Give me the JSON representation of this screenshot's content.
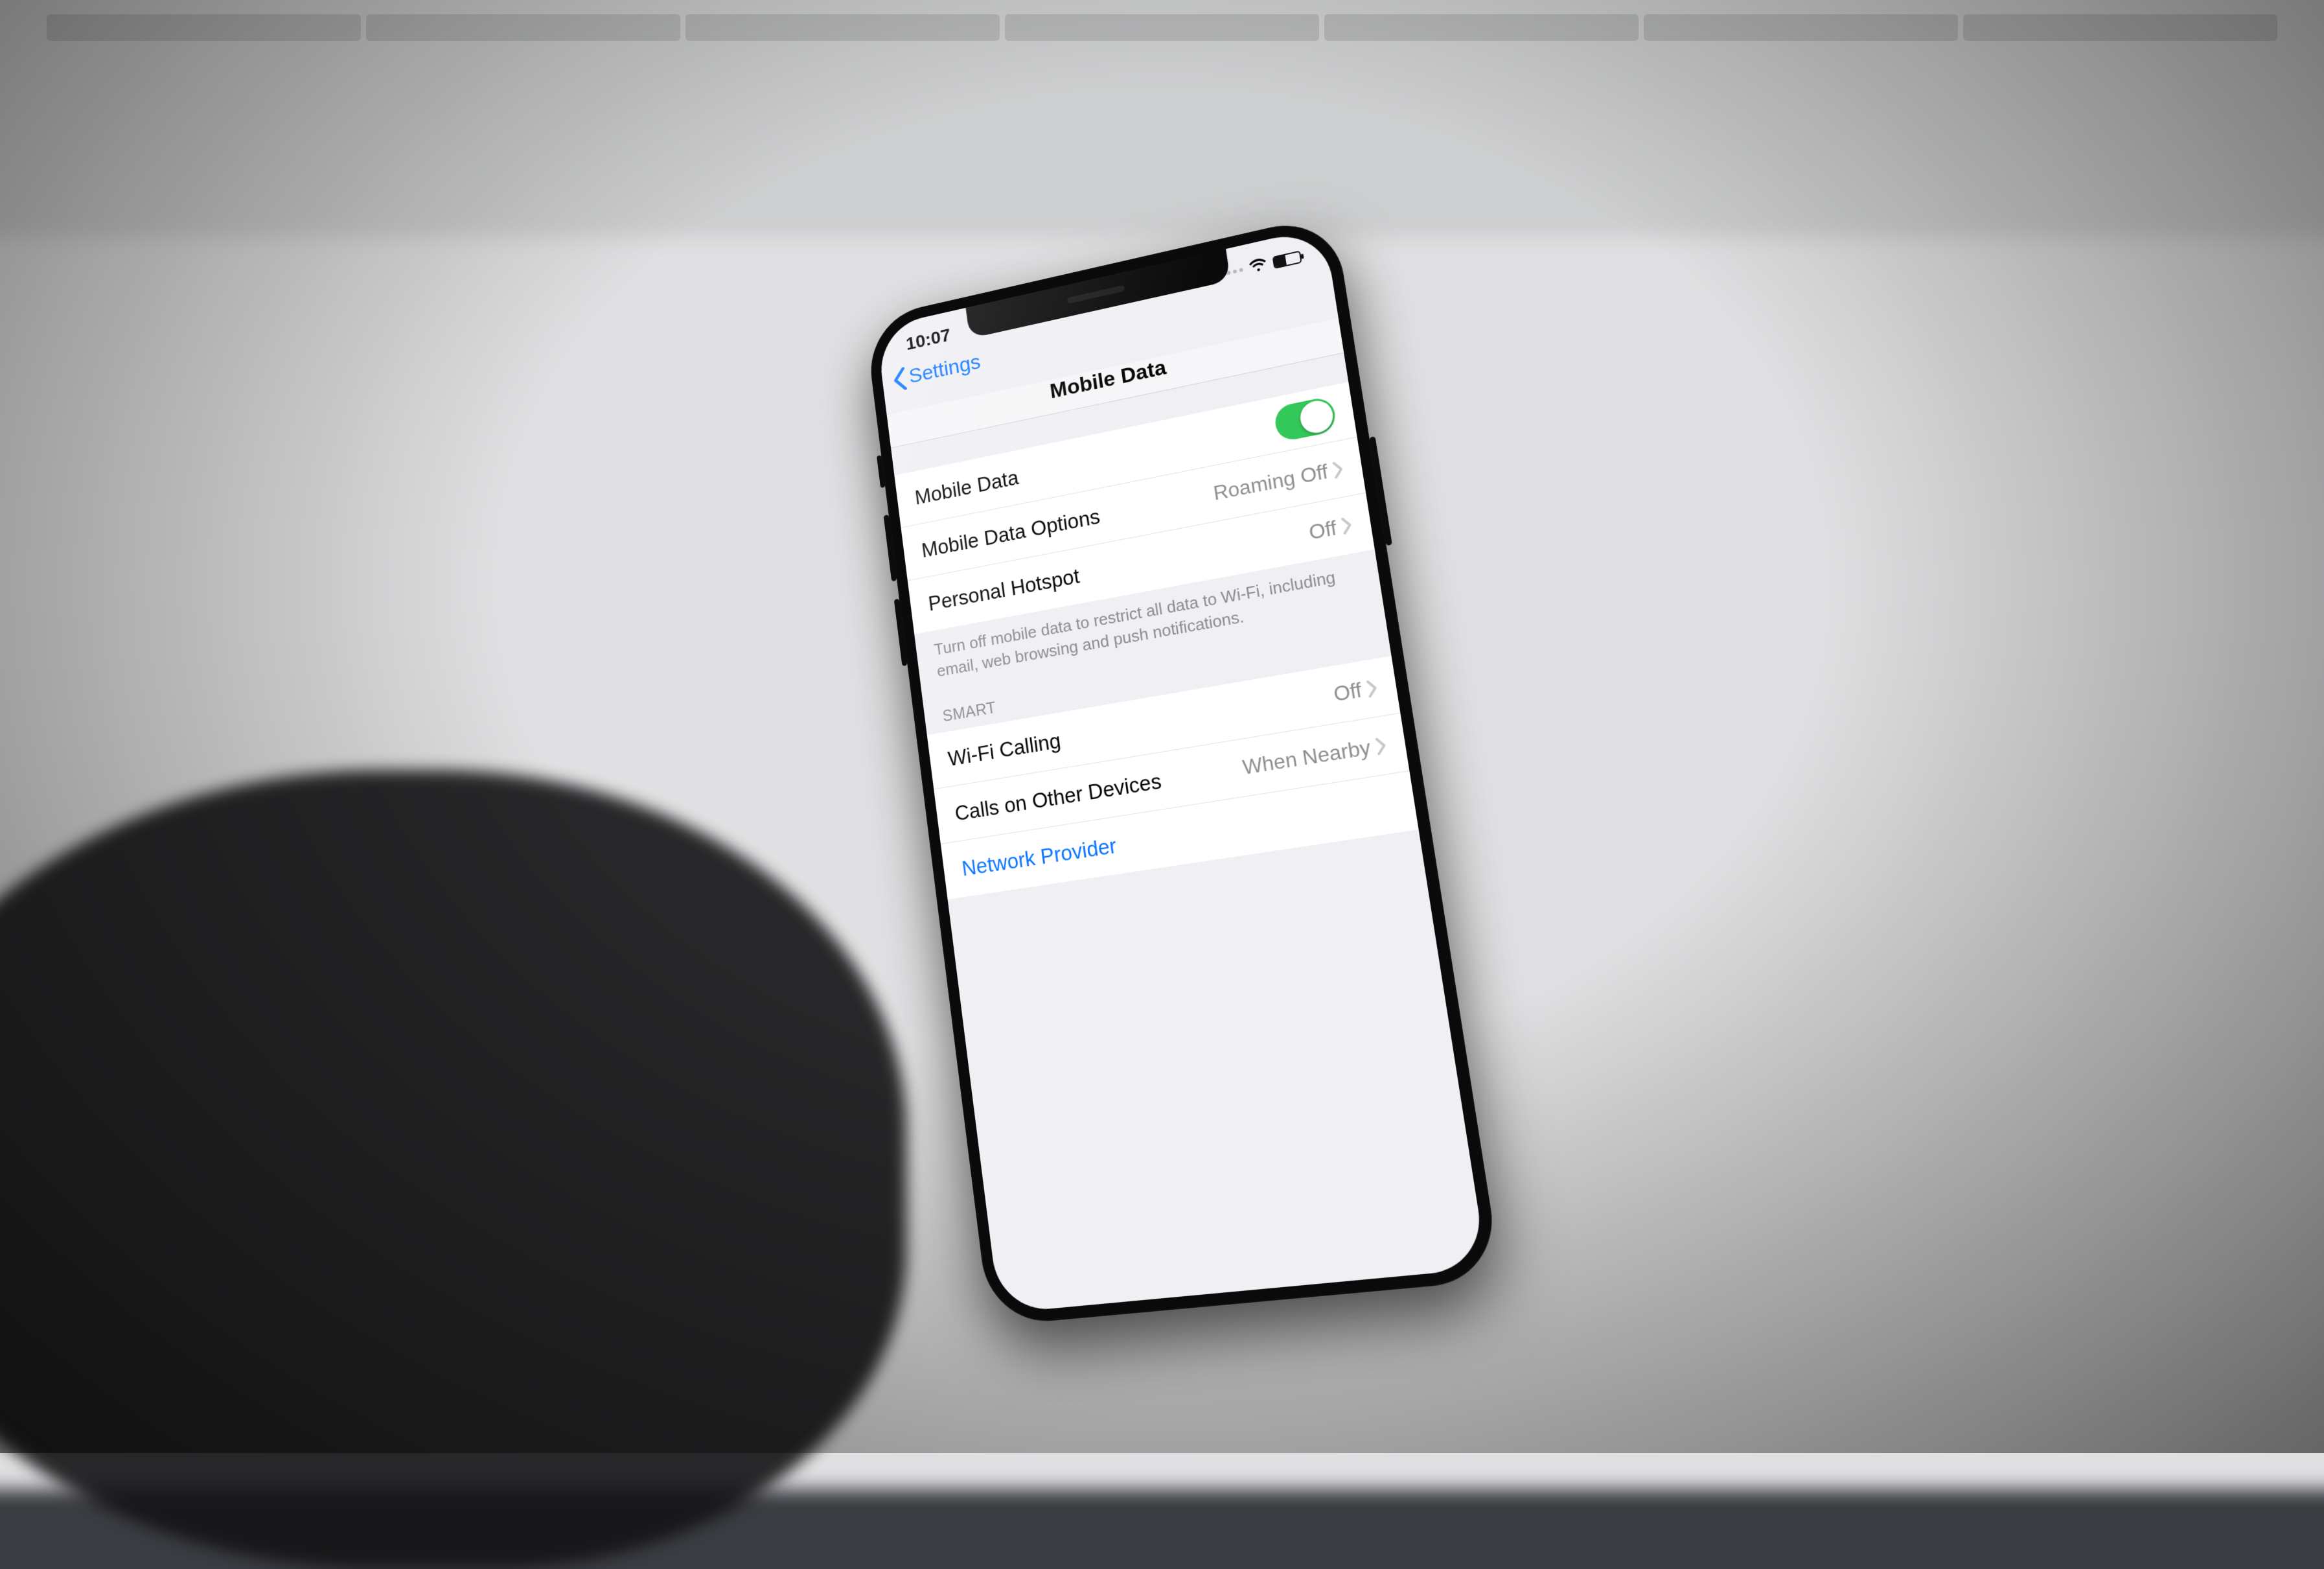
{
  "statusbar": {
    "time": "10:07",
    "battery_level_pct": 45
  },
  "nav": {
    "back_label": "Settings",
    "title": "Mobile Data"
  },
  "group1": {
    "mobile_data_label": "Mobile Data",
    "mobile_data_on": true,
    "options_label": "Mobile Data Options",
    "options_value": "Roaming Off",
    "hotspot_label": "Personal Hotspot",
    "hotspot_value": "Off",
    "footer": "Turn off mobile data to restrict all data to Wi-Fi, including email, web browsing and push notifications."
  },
  "group2": {
    "header": "SMART",
    "wifi_calling_label": "Wi-Fi Calling",
    "wifi_calling_value": "Off",
    "other_devices_label": "Calls on Other Devices",
    "other_devices_value": "When Nearby",
    "network_provider_label": "Network Provider"
  }
}
